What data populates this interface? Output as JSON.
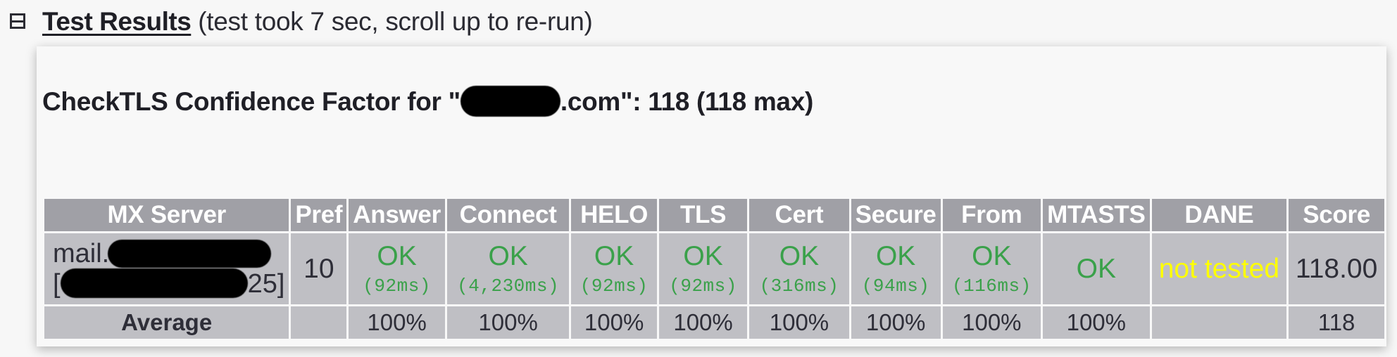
{
  "section": {
    "title": "Test Results",
    "note": "(test took 7 sec, scroll up to re-run)",
    "toggle_icon": "collapse-box-icon"
  },
  "confidence": {
    "prefix": "CheckTLS Confidence Factor for \"",
    "domain_suffix": ".com\": 118 (118 max)"
  },
  "table": {
    "headers": [
      "MX Server",
      "Pref",
      "Answer",
      "Connect",
      "HELO",
      "TLS",
      "Cert",
      "Secure",
      "From",
      "MTASTS",
      "DANE",
      "Score"
    ],
    "row": {
      "mx_line1_prefix": "mail.",
      "mx_line2_prefix": "[",
      "mx_line2_suffix": "25]",
      "pref": "10",
      "answer": {
        "status": "OK",
        "time": "(92ms)"
      },
      "connect": {
        "status": "OK",
        "time": "(4,230ms)"
      },
      "helo": {
        "status": "OK",
        "time": "(92ms)"
      },
      "tls": {
        "status": "OK",
        "time": "(92ms)"
      },
      "cert": {
        "status": "OK",
        "time": "(316ms)"
      },
      "secure": {
        "status": "OK",
        "time": "(94ms)"
      },
      "from": {
        "status": "OK",
        "time": "(116ms)"
      },
      "mtasts": {
        "status": "OK"
      },
      "dane": {
        "status": "not tested"
      },
      "score": "118.00"
    },
    "average": {
      "label": "Average",
      "pref": "",
      "answer": "100%",
      "connect": "100%",
      "helo": "100%",
      "tls": "100%",
      "cert": "100%",
      "secure": "100%",
      "from": "100%",
      "mtasts": "100%",
      "dane": "",
      "score": "118"
    }
  },
  "colors": {
    "ok": "#3aa14a",
    "not_tested": "#ffff00",
    "header_bg": "#a0a0a6",
    "cell_bg": "#bfbfc4"
  }
}
